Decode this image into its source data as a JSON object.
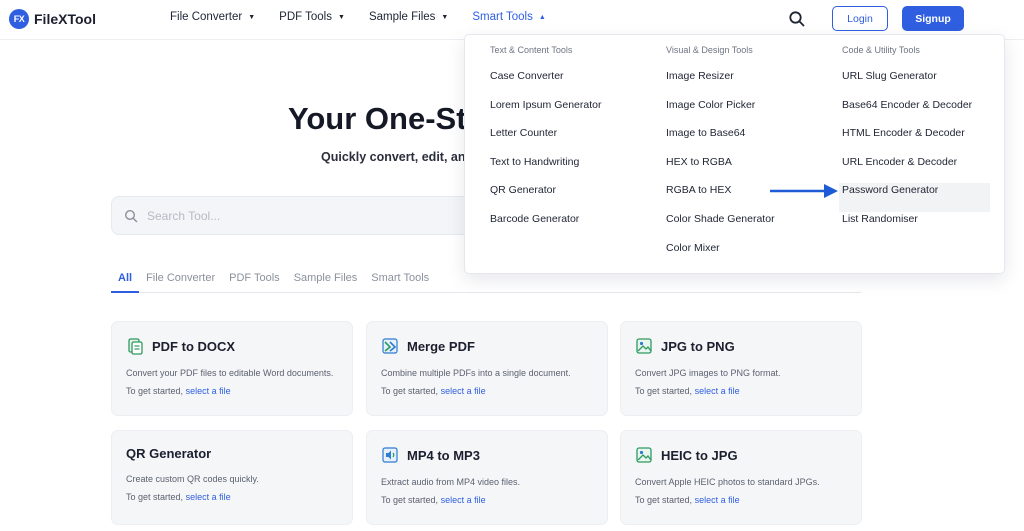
{
  "brand": {
    "mark": "FX",
    "name": "FileXTool"
  },
  "nav": {
    "items": [
      {
        "label": "File Converter"
      },
      {
        "label": "PDF Tools"
      },
      {
        "label": "Sample Files"
      },
      {
        "label": "Smart Tools"
      }
    ],
    "login": "Login",
    "signup": "Signup"
  },
  "hero": {
    "title": "Your One-Sto",
    "subtitle": "Quickly convert, edit, an"
  },
  "search": {
    "placeholder": "Search Tool..."
  },
  "tabs": [
    "All",
    "File Converter",
    "PDF Tools",
    "Sample Files",
    "Smart Tools"
  ],
  "cards": [
    {
      "icon": "docx-icon",
      "title": "PDF to DOCX",
      "desc": "Convert your PDF files to editable Word documents.",
      "cta_prefix": "To get started,",
      "cta_link": "select a file"
    },
    {
      "icon": "merge-icon",
      "title": "Merge PDF",
      "desc": "Combine multiple PDFs into a single document.",
      "cta_prefix": "To get started,",
      "cta_link": "select a file"
    },
    {
      "icon": "image-icon",
      "title": "JPG to PNG",
      "desc": "Convert JPG images to PNG format.",
      "cta_prefix": "To get started,",
      "cta_link": "select a file"
    },
    {
      "icon": "",
      "title": "QR Generator",
      "desc": "Create custom QR codes quickly.",
      "cta_prefix": "To get started,",
      "cta_link": "select a file"
    },
    {
      "icon": "audio-icon",
      "title": "MP4 to MP3",
      "desc": "Extract audio from MP4 video files.",
      "cta_prefix": "To get started,",
      "cta_link": "select a file"
    },
    {
      "icon": "image-icon",
      "title": "HEIC to JPG",
      "desc": "Convert Apple HEIC photos to standard JPGs.",
      "cta_prefix": "To get started,",
      "cta_link": "select a file"
    }
  ],
  "dropdown": {
    "columns": [
      {
        "heading": "Text & Content Tools",
        "items": [
          "Case Converter",
          "Lorem Ipsum Generator",
          "Letter Counter",
          "Text to Handwriting",
          "QR Generator",
          "Barcode Generator"
        ]
      },
      {
        "heading": "Visual & Design Tools",
        "items": [
          "Image Resizer",
          "Image Color Picker",
          "Image to Base64",
          "HEX to RGBA",
          "RGBA to HEX",
          "Color Shade Generator",
          "Color Mixer"
        ]
      },
      {
        "heading": "Code & Utility Tools",
        "items": [
          "URL Slug Generator",
          "Base64 Encoder & Decoder",
          "HTML Encoder & Decoder",
          "URL Encoder & Decoder",
          "Password Generator",
          "List Randomiser"
        ]
      }
    ],
    "highlighted": "Password Generator"
  },
  "colors": {
    "accent": "#2f5fe0",
    "card_bg": "#f5f6f8",
    "arrow": "#1f5bd6"
  }
}
